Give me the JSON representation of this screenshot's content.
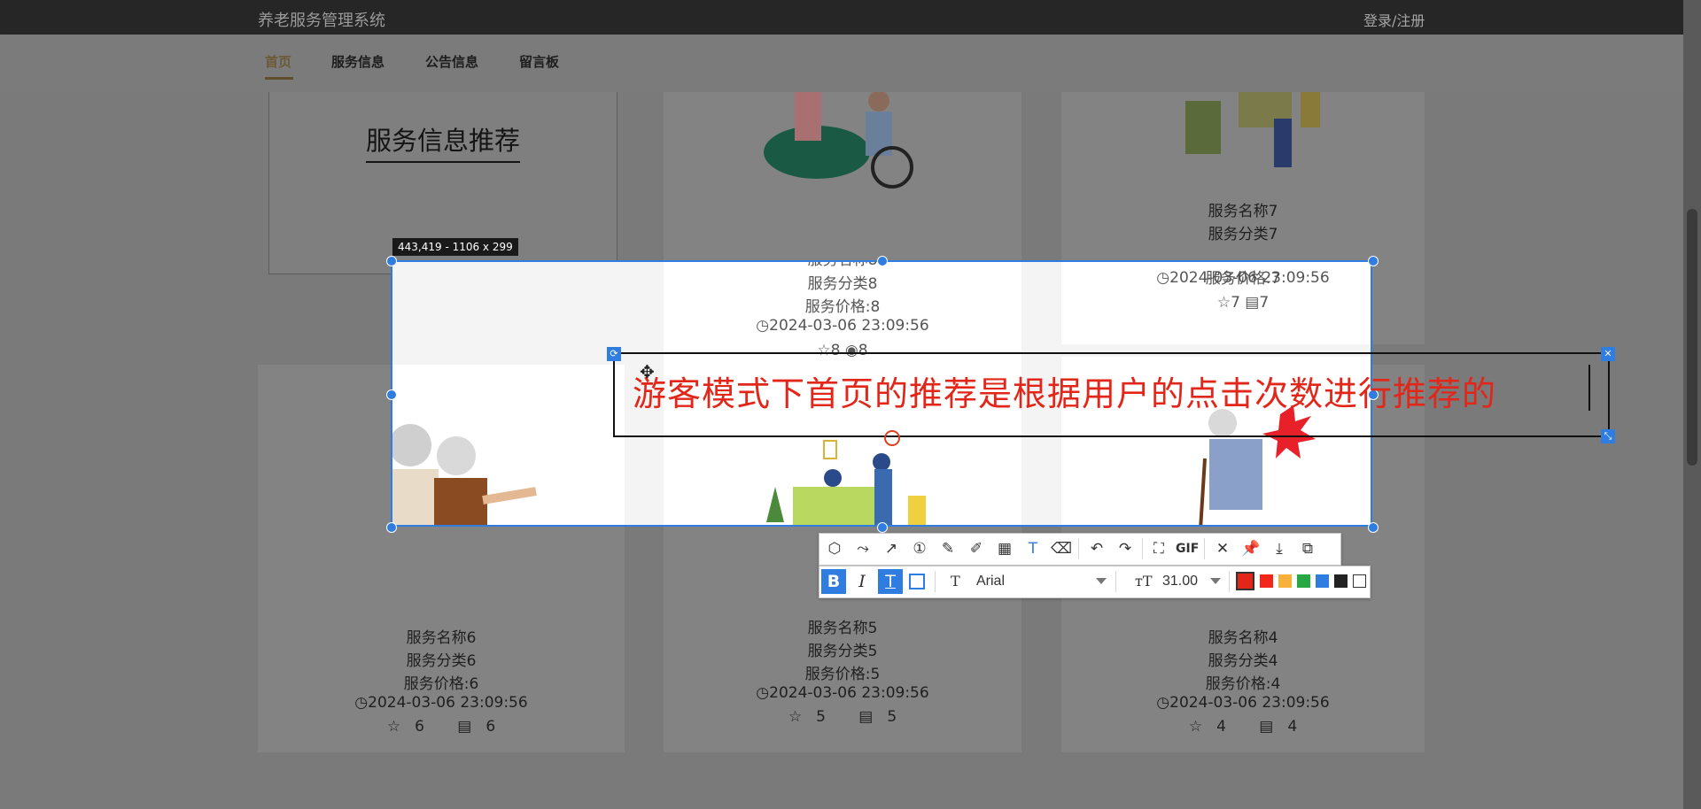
{
  "header": {
    "system_title": "养老服务管理系统",
    "login_link": "登录/注册"
  },
  "nav": {
    "items": [
      {
        "label": "首页",
        "active": true
      },
      {
        "label": "服务信息",
        "active": false
      },
      {
        "label": "公告信息",
        "active": false
      },
      {
        "label": "留言板",
        "active": false
      }
    ]
  },
  "recommend": {
    "title": "服务信息推荐"
  },
  "cards": [
    {
      "name": "服务名称8",
      "category": "服务分类8",
      "price": "服务价格:8",
      "time": "2024-03-06 23:09:56",
      "favorites": "8",
      "views": "8"
    },
    {
      "name": "服务名称7",
      "category": "服务分类7",
      "price": "服务价格:7",
      "time": "2024-03-06 23:09:56",
      "favorites": "7",
      "views": "7"
    },
    {
      "name": "服务名称6",
      "category": "服务分类6",
      "price": "服务价格:6",
      "time": "2024-03-06 23:09:56",
      "favorites": "6",
      "views": "6"
    },
    {
      "name": "服务名称5",
      "category": "服务分类5",
      "price": "服务价格:5",
      "time": "2024-03-06 23:09:56",
      "favorites": "5",
      "views": "5"
    },
    {
      "name": "服务名称4",
      "category": "服务分类4",
      "price": "服务价格:4",
      "time": "2024-03-06 23:09:56",
      "favorites": "4",
      "views": "4"
    }
  ],
  "capture": {
    "dimensions_label": "443,419 - 1106 x 299",
    "annotation_text": "游客模式下首页的推荐是根据用户的点击次数进行推荐的",
    "annotation_color": "#e2261a",
    "accent_color": "#2f7de1"
  },
  "toolbar": {
    "tools": [
      "shape-icon",
      "curve-icon",
      "arrow-icon",
      "number-marker-icon",
      "pen-icon",
      "marker-icon",
      "mosaic-icon",
      "text-icon",
      "eraser-icon",
      "undo-icon",
      "redo-icon",
      "ocr-icon",
      "gif",
      "close-icon",
      "pin-icon",
      "download-icon",
      "copy-icon"
    ],
    "gif_label": "GIF",
    "font_name": "Arial",
    "font_size": "31.00",
    "bold_label": "B",
    "italic_label": "I",
    "outline_label": "T",
    "colors": [
      "#e2261a",
      "#f2261a",
      "#f6b23a",
      "#28a745",
      "#2f7de1",
      "#222222",
      "#ffffff"
    ]
  }
}
